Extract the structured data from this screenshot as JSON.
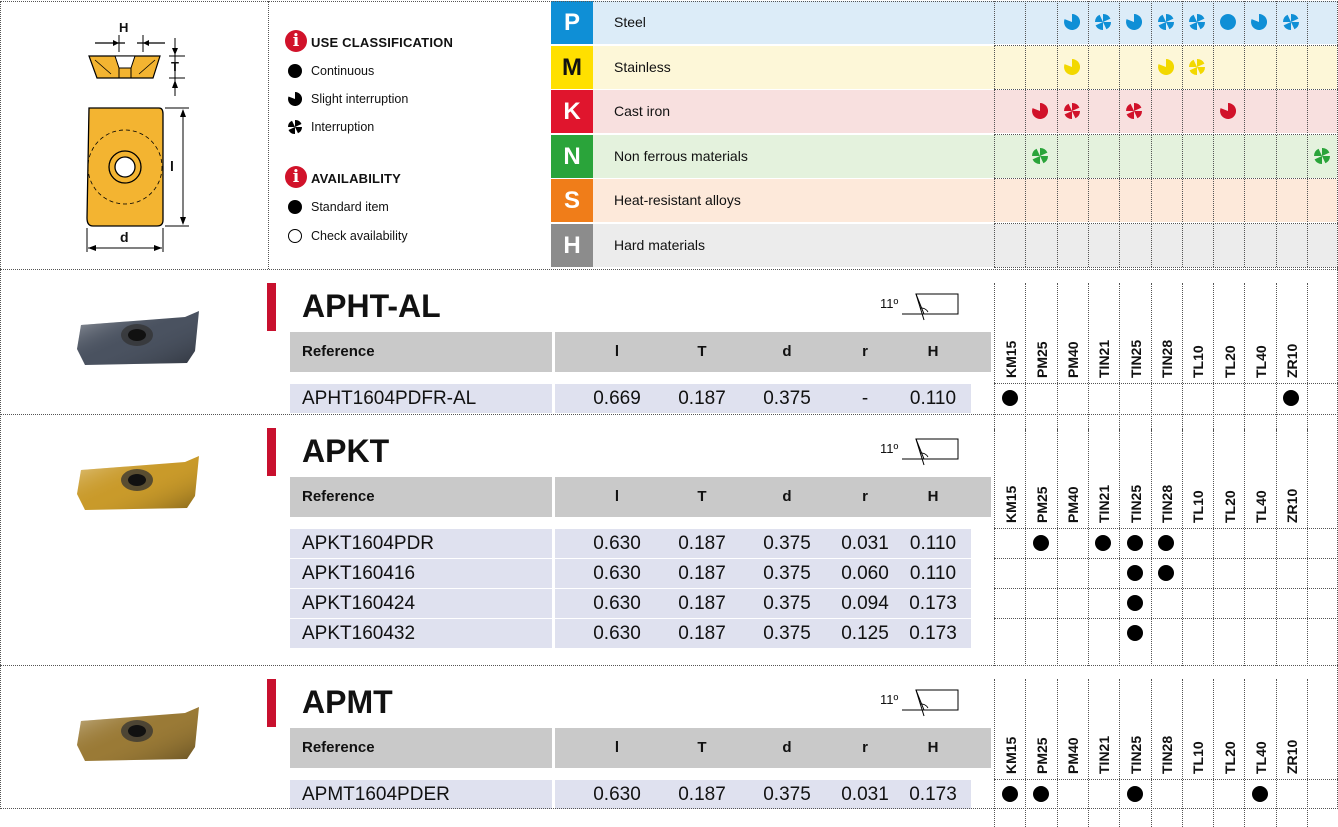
{
  "legend": {
    "use_title": "USE CLASSIFICATION",
    "use_items": [
      "Continuous",
      "Slight interruption",
      "Interruption"
    ],
    "avail_title": "AVAILABILITY",
    "avail_items": [
      "Standard item",
      "Check availability"
    ]
  },
  "diagram": {
    "labels": {
      "H": "H",
      "T": "T",
      "l": "l",
      "d": "d"
    }
  },
  "materials": [
    {
      "letter": "P",
      "name": "Steel",
      "color": "#0f8fd6",
      "bg": "#dcecf8",
      "marks": [
        "",
        "",
        "slight",
        "interrupt",
        "slight",
        "interrupt",
        "interrupt",
        "continuous",
        "slight",
        "interrupt",
        ""
      ],
      "mark_color": "#0f8fd6"
    },
    {
      "letter": "M",
      "name": "Stainless",
      "color": "#ffe000",
      "bg": "#fdf7d8",
      "marks": [
        "",
        "",
        "slight",
        "",
        "",
        "slight",
        "interrupt",
        "",
        "",
        "",
        ""
      ],
      "mark_color": "#f2d800"
    },
    {
      "letter": "K",
      "name": "Cast iron",
      "color": "#e0152d",
      "bg": "#f8e0df",
      "marks": [
        "",
        "slight",
        "interrupt",
        "",
        "interrupt",
        "",
        "",
        "slight",
        "",
        "",
        ""
      ],
      "mark_color": "#d1122a"
    },
    {
      "letter": "N",
      "name": "Non ferrous materials",
      "color": "#2aa43a",
      "bg": "#e4f2dd",
      "marks": [
        "",
        "interrupt",
        "",
        "",
        "",
        "",
        "",
        "",
        "",
        "",
        "interrupt"
      ],
      "mark_color": "#2aa43a"
    },
    {
      "letter": "S",
      "name": "Heat-resistant alloys",
      "color": "#f07d19",
      "bg": "#fde9da",
      "marks": [
        "",
        "",
        "",
        "",
        "",
        "",
        "",
        "",
        "",
        "",
        ""
      ],
      "mark_color": "#f07d19"
    },
    {
      "letter": "H",
      "name": "Hard materials",
      "color": "#8c8c8c",
      "bg": "#ececec",
      "marks": [
        "",
        "",
        "",
        "",
        "",
        "",
        "",
        "",
        "",
        "",
        ""
      ],
      "mark_color": "#8c8c8c"
    }
  ],
  "grades": [
    "KM15",
    "PM25",
    "PM40",
    "TIN21",
    "TIN25",
    "TIN28",
    "TL10",
    "TL20",
    "TL40",
    "ZR10"
  ],
  "columns": {
    "reference": "Reference",
    "l": "l",
    "T": "T",
    "d": "d",
    "r": "r",
    "H": "H"
  },
  "angle": "11º",
  "families": [
    {
      "title": "APHT-AL",
      "insert_color": "#4a5260",
      "rows": [
        {
          "ref": "APHT1604PDFR-AL",
          "l": "0.669",
          "T": "0.187",
          "d": "0.375",
          "r": "-",
          "H": "0.110",
          "avail": [
            1,
            0,
            0,
            0,
            0,
            0,
            0,
            0,
            0,
            1
          ]
        }
      ]
    },
    {
      "title": "APKT",
      "insert_color": "#c99a2a",
      "rows": [
        {
          "ref": "APKT1604PDR",
          "l": "0.630",
          "T": "0.187",
          "d": "0.375",
          "r": "0.031",
          "H": "0.110",
          "avail": [
            0,
            1,
            0,
            1,
            1,
            1,
            0,
            0,
            0,
            0
          ]
        },
        {
          "ref": "APKT160416",
          "l": "0.630",
          "T": "0.187",
          "d": "0.375",
          "r": "0.060",
          "H": "0.110",
          "avail": [
            0,
            0,
            0,
            0,
            1,
            1,
            0,
            0,
            0,
            0
          ]
        },
        {
          "ref": "APKT160424",
          "l": "0.630",
          "T": "0.187",
          "d": "0.375",
          "r": "0.094",
          "H": "0.173",
          "avail": [
            0,
            0,
            0,
            0,
            1,
            0,
            0,
            0,
            0,
            0
          ]
        },
        {
          "ref": "APKT160432",
          "l": "0.630",
          "T": "0.187",
          "d": "0.375",
          "r": "0.125",
          "H": "0.173",
          "avail": [
            0,
            0,
            0,
            0,
            1,
            0,
            0,
            0,
            0,
            0
          ]
        }
      ]
    },
    {
      "title": "APMT",
      "insert_color": "#9a7a36",
      "rows": [
        {
          "ref": "APMT1604PDER",
          "l": "0.630",
          "T": "0.187",
          "d": "0.375",
          "r": "0.031",
          "H": "0.173",
          "avail": [
            1,
            1,
            0,
            0,
            1,
            0,
            0,
            0,
            1,
            0
          ]
        }
      ]
    }
  ]
}
